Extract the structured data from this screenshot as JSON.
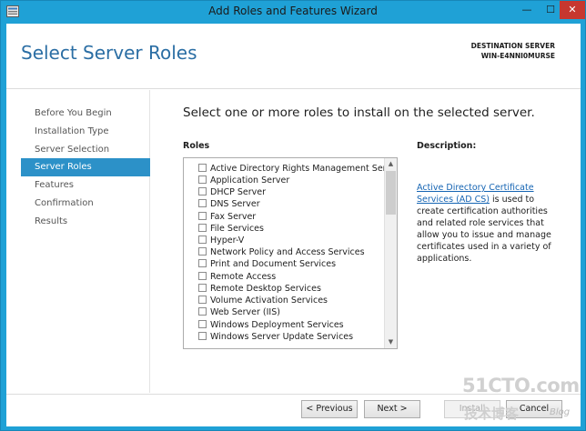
{
  "window": {
    "title": "Add Roles and Features Wizard",
    "minimize_glyph": "—",
    "maximize_glyph": "☐",
    "close_glyph": "✕"
  },
  "header": {
    "page_title": "Select Server Roles",
    "destination_label": "DESTINATION SERVER",
    "destination_value": "WIN-E4NNI0MURSE"
  },
  "nav": {
    "items": [
      {
        "label": "Before You Begin",
        "active": false
      },
      {
        "label": "Installation Type",
        "active": false
      },
      {
        "label": "Server Selection",
        "active": false
      },
      {
        "label": "Server Roles",
        "active": true
      },
      {
        "label": "Features",
        "active": false
      },
      {
        "label": "Confirmation",
        "active": false
      },
      {
        "label": "Results",
        "active": false
      }
    ]
  },
  "main": {
    "heading": "Select one or more roles to install on the selected server.",
    "roles_label": "Roles",
    "description_label": "Description:",
    "roles": [
      {
        "label": "Active Directory Rights Management Services",
        "checked": false
      },
      {
        "label": "Application Server",
        "checked": false
      },
      {
        "label": "DHCP Server",
        "checked": false
      },
      {
        "label": "DNS Server",
        "checked": false
      },
      {
        "label": "Fax Server",
        "checked": false
      },
      {
        "label": "File Services",
        "checked": false
      },
      {
        "label": "Hyper-V",
        "checked": false
      },
      {
        "label": "Network Policy and Access Services",
        "checked": false
      },
      {
        "label": "Print and Document Services",
        "checked": false
      },
      {
        "label": "Remote Access",
        "checked": false
      },
      {
        "label": "Remote Desktop Services",
        "checked": false
      },
      {
        "label": "Volume Activation Services",
        "checked": false
      },
      {
        "label": "Web Server (IIS)",
        "checked": false
      },
      {
        "label": "Windows Deployment Services",
        "checked": false
      },
      {
        "label": "Windows Server Update Services",
        "checked": false
      }
    ],
    "description": {
      "link_text": "Active Directory Certificate Services (AD CS)",
      "body_text": " is used to create certification authorities and related role services that allow you to issue and manage certificates used in a variety of applications."
    }
  },
  "footer": {
    "previous_label": "< Previous",
    "next_label": "Next >",
    "install_label": "Install",
    "cancel_label": "Cancel"
  },
  "watermark": {
    "main": "51CTO.com",
    "sub": "技术博客",
    "blog": "Blog"
  },
  "colors": {
    "titlebar": "#1fa1d6",
    "accent": "#2c91c8",
    "title_text": "#2b6ea4",
    "link": "#1564b3",
    "close_button": "#c7372f"
  }
}
